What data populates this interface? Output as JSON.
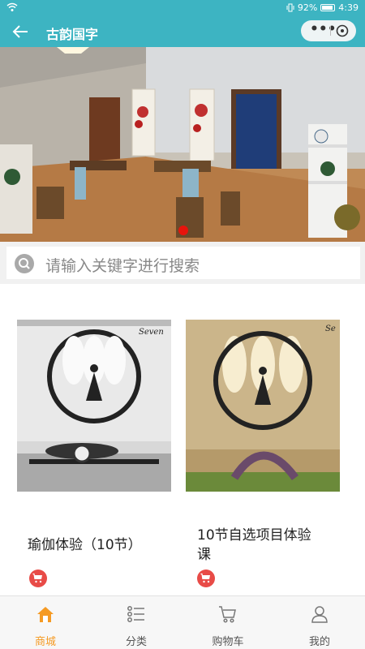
{
  "status_bar": {
    "battery": "92%",
    "time": "4:39"
  },
  "header": {
    "title": "古韵国字",
    "more_label": "•••"
  },
  "search": {
    "placeholder": "请输入关键字进行搜索"
  },
  "products": [
    {
      "title": "瑜伽体验（10节）"
    },
    {
      "title_line1": "10节自选项目体验",
      "title_line2": "课"
    }
  ],
  "tabs": [
    {
      "label": "商城",
      "icon": "home-icon",
      "active": true
    },
    {
      "label": "分类",
      "icon": "category-list-icon",
      "active": false
    },
    {
      "label": "购物车",
      "icon": "cart-icon",
      "active": false
    },
    {
      "label": "我的",
      "icon": "user-icon",
      "active": false
    }
  ],
  "colors": {
    "accent": "#3db4c2",
    "active_tab": "#f59a23",
    "cart_button": "#e84b47",
    "banner_dot": "#e8140c"
  }
}
